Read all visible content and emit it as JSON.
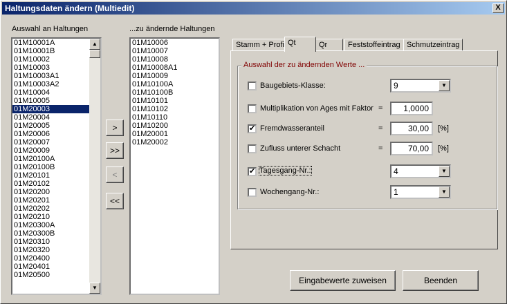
{
  "window": {
    "title": "Haltungsdaten ändern (Multiedit)",
    "close_label": "X"
  },
  "left_list": {
    "label": "Auswahl an Haltungen",
    "items": [
      "01M10001A",
      "01M10001B",
      "01M10002",
      "01M10003",
      "01M10003A1",
      "01M10003A2",
      "01M10004",
      "01M10005",
      "01M20003",
      "01M20004",
      "01M20005",
      "01M20006",
      "01M20007",
      "01M20009",
      "01M20100A",
      "01M20100B",
      "01M20101",
      "01M20102",
      "01M20200",
      "01M20201",
      "01M20202",
      "01M20210",
      "01M20300A",
      "01M20300B",
      "01M20310",
      "01M20320",
      "01M20400",
      "01M20401",
      "01M20500"
    ],
    "selected_item": "01M20003"
  },
  "right_list": {
    "label": "...zu ändernde Haltungen",
    "items": [
      "01M10006",
      "01M10007",
      "01M10008",
      "01M10008A1",
      "01M10009",
      "01M10100A",
      "01M10100B",
      "01M10101",
      "01M10102",
      "01M10110",
      "01M10200",
      "01M20001",
      "01M20002"
    ]
  },
  "transfer_buttons": {
    "add": ">",
    "add_all": ">>",
    "remove": "<",
    "remove_all": "<<"
  },
  "tabs": [
    "Stamm + Profil",
    "Qt",
    "Qr",
    "Feststoffeintrag",
    "Schmutzeintrag"
  ],
  "active_tab": "Qt",
  "group": {
    "title": "Auswahl der zu ändernden Werte ...",
    "rows": [
      {
        "label": "Baugebiets-Klasse:",
        "checked": false,
        "combo_value": "9"
      },
      {
        "label": "Multiplikation von Ages mit Faktor",
        "checked": false,
        "eq": "=",
        "value": "1,0000"
      },
      {
        "label": "Fremdwasseranteil",
        "checked": true,
        "eq": "=",
        "value": "30,00",
        "unit": "[%]"
      },
      {
        "label": "Zufluss unterer Schacht",
        "checked": false,
        "eq": "=",
        "value": "70,00",
        "unit": "[%]"
      },
      {
        "label": "Tagesgang-Nr.:",
        "checked": true,
        "combo_value": "4"
      },
      {
        "label": "Wochengang-Nr.:",
        "checked": false,
        "combo_value": "1"
      }
    ]
  },
  "buttons": {
    "assign": "Eingabewerte zuweisen",
    "close": "Beenden"
  },
  "icons": {
    "check": "✔",
    "arrow_up": "▲",
    "arrow_down": "▼"
  }
}
